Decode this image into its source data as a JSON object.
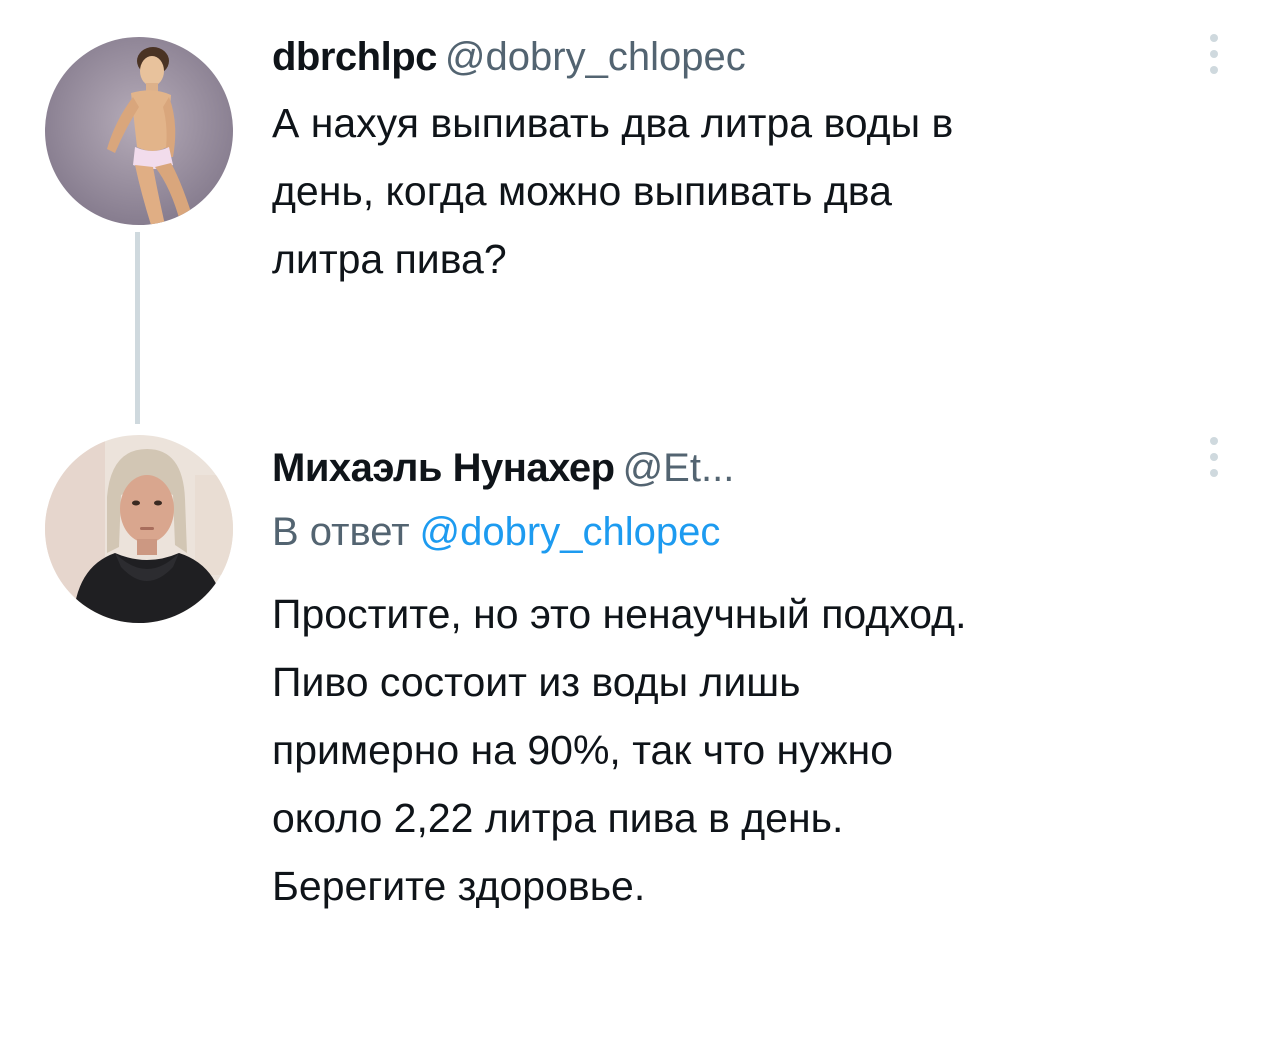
{
  "thread": {
    "original_tweet": {
      "display_name": "dbrchlpc",
      "handle": "@dobry_chlopec",
      "text": "А нахуя выпивать два литра воды в\nдень, когда можно выпивать два\nлитра пива?",
      "avatar_icon": "avatar-doll-figure-icon",
      "more_icon": "more-options-icon"
    },
    "reply_tweet": {
      "display_name": "Михаэль Нунахер",
      "handle": "@Et...",
      "reply_prefix": "В ответ",
      "reply_mention": "@dobry_chlopec",
      "text": "Простите, но это ненаучный подход.\nПиво состоит из воды лишь\nпримерно на 90%, так что нужно\nоколо 2,22 литра пива в день.\nБерегите здоровье.",
      "avatar_icon": "avatar-man-photo-icon",
      "more_icon": "more-options-icon"
    }
  },
  "colors": {
    "text_primary": "#0f1419",
    "text_secondary": "#536471",
    "link": "#1d9bf0",
    "thread_line": "#cfd9de"
  }
}
